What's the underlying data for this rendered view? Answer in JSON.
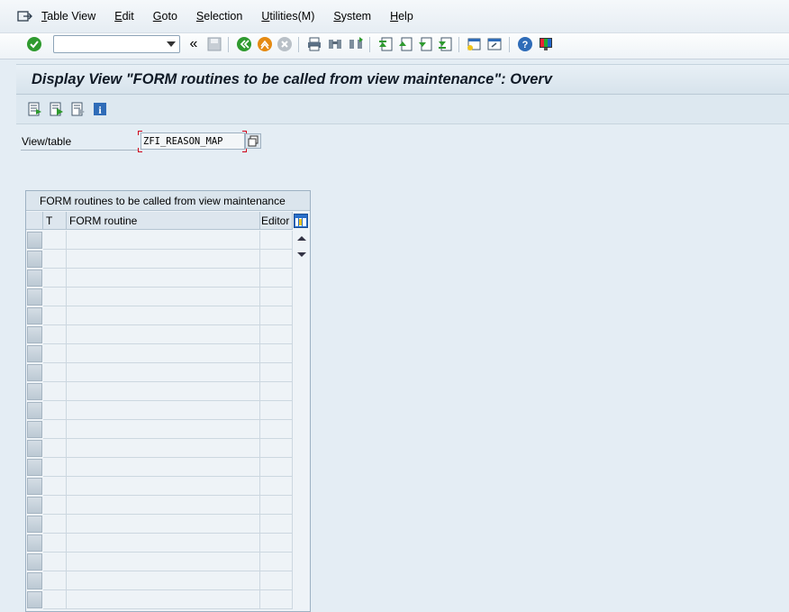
{
  "menu": {
    "items": [
      {
        "label": "Table View"
      },
      {
        "label": "Edit"
      },
      {
        "label": "Goto"
      },
      {
        "label": "Selection"
      },
      {
        "label": "Utilities(M)"
      },
      {
        "label": "System"
      },
      {
        "label": "Help"
      }
    ]
  },
  "toolbar": {
    "command_field_value": "",
    "icons": [
      "enter-icon",
      "command-field",
      "back-double-icon",
      "save-icon",
      "back-icon",
      "exit-icon",
      "cancel-icon",
      "print-icon",
      "find-icon",
      "find-next-icon",
      "first-page-icon",
      "previous-page-icon",
      "next-page-icon",
      "last-page-icon",
      "new-session-icon",
      "shortcut-icon",
      "help-icon",
      "customize-layout-icon"
    ]
  },
  "title": "Display View \"FORM routines to be called from view maintenance\": Overv",
  "app_toolbar": {
    "icons": [
      "display-change-icon",
      "next-icon",
      "previous-icon",
      "info-icon"
    ]
  },
  "field": {
    "label": "View/table",
    "value": "ZFI_REASON_MAP"
  },
  "table": {
    "title": "FORM routines to be called from view maintenance",
    "columns": [
      "T",
      "FORM routine",
      "Editor"
    ],
    "rows": 20
  },
  "colors": {
    "background": "#e4edf4",
    "title_text": "#101a26",
    "required_marker": "#d0021b"
  }
}
